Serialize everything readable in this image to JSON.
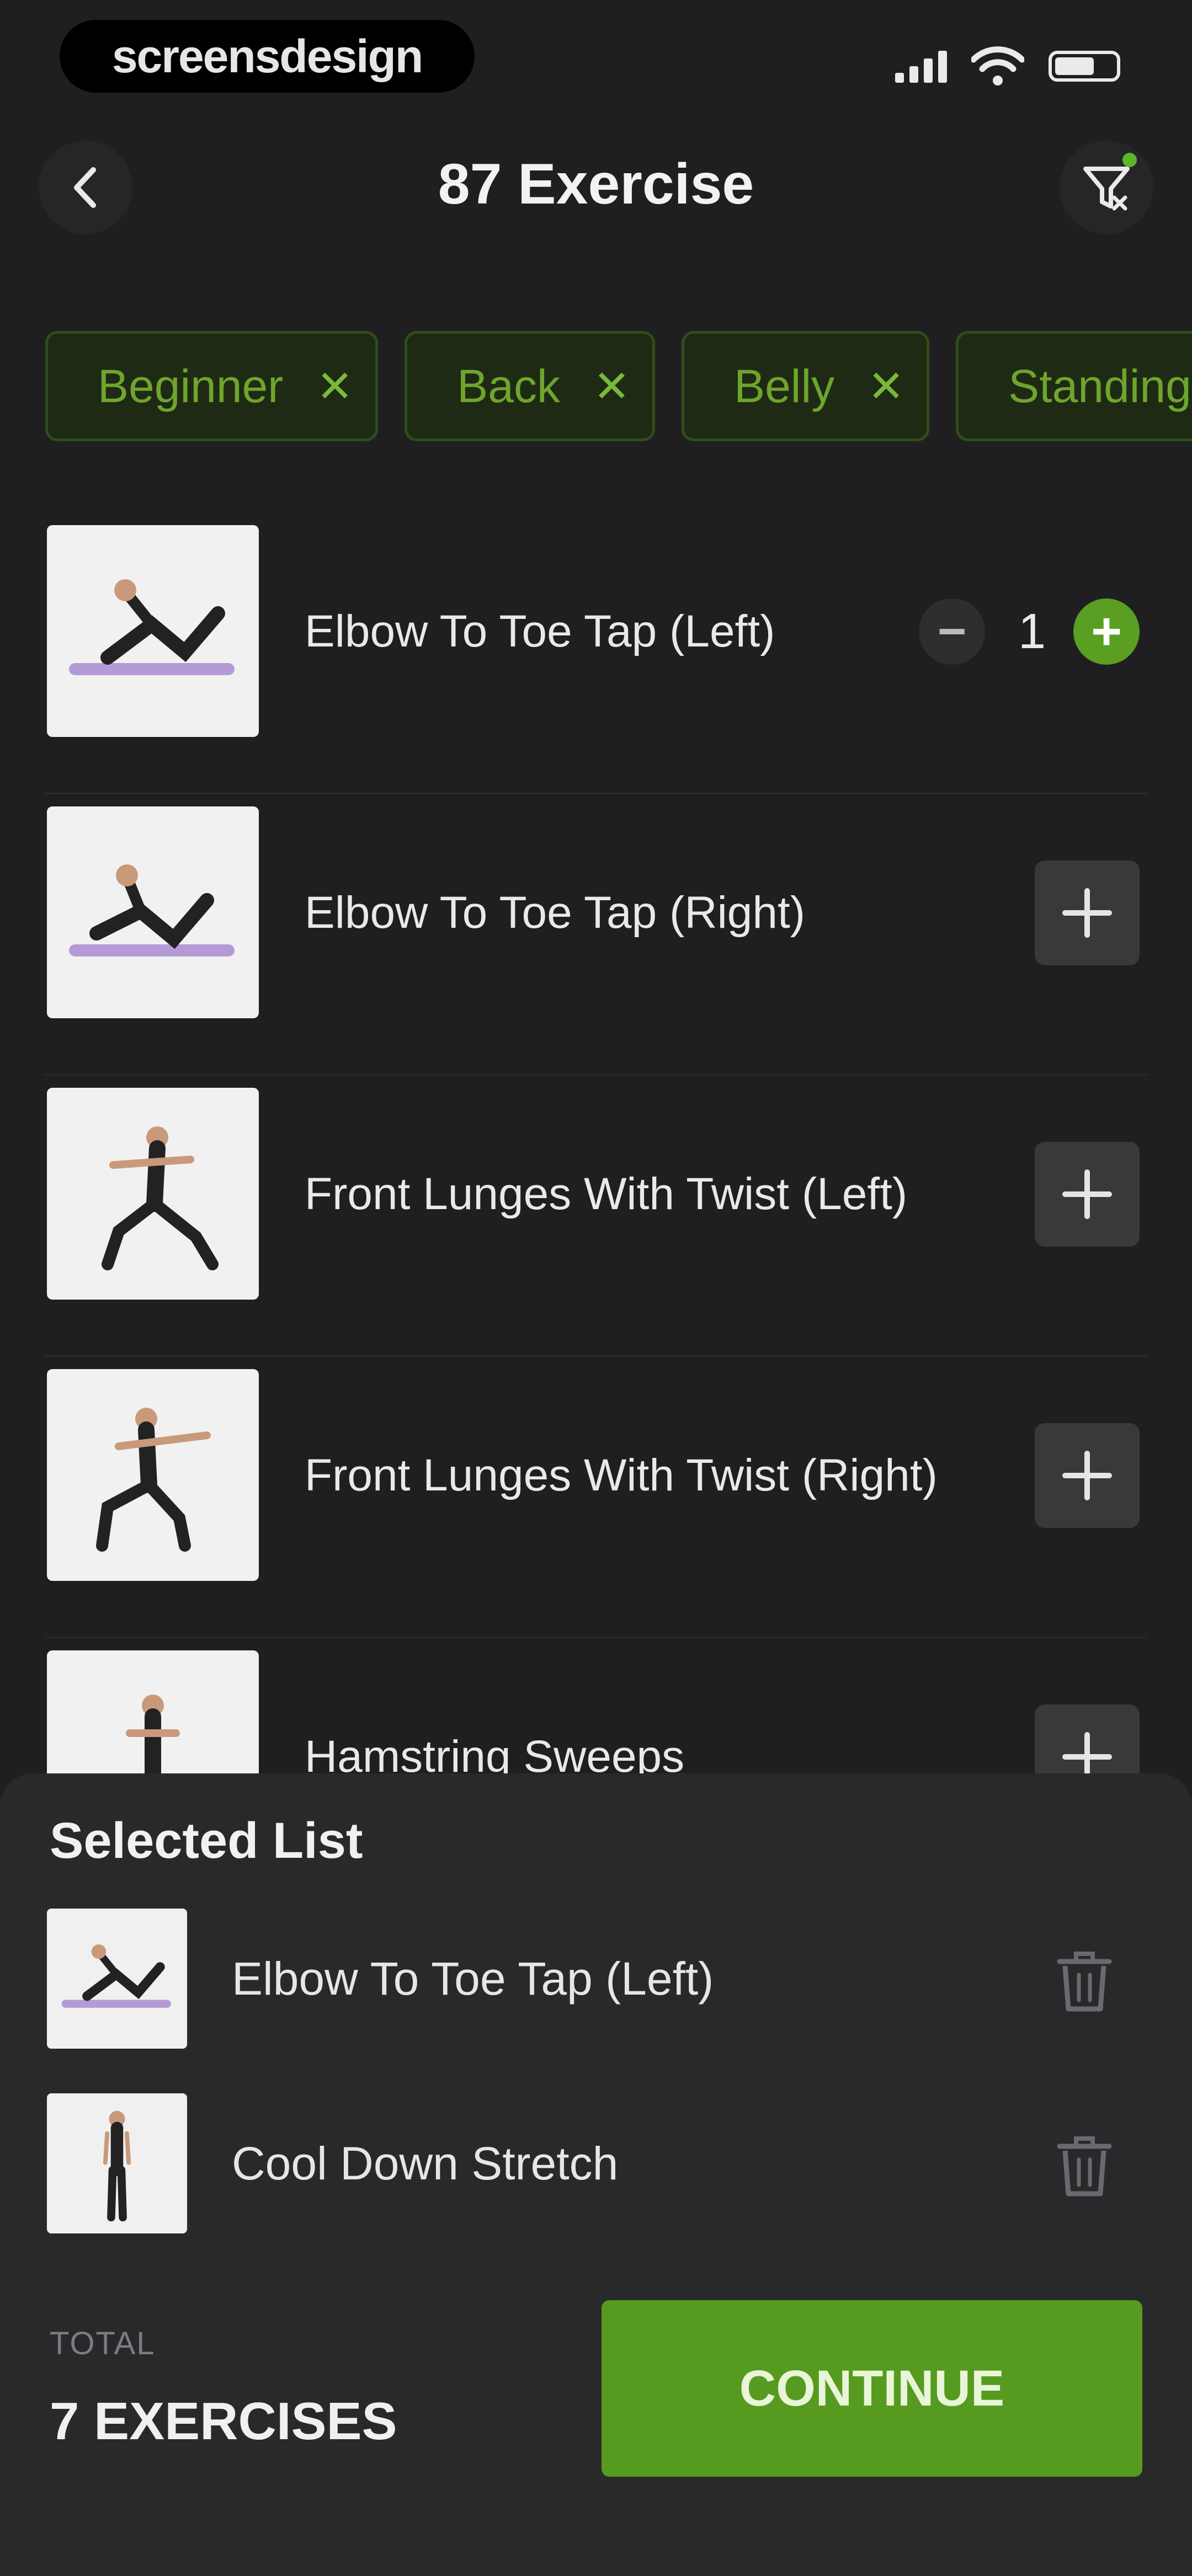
{
  "status_bar": {
    "brand": "screensdesign",
    "icons": [
      "signal-icon",
      "wifi-icon",
      "battery-icon"
    ]
  },
  "header": {
    "title": "87 Exercise",
    "back_icon": "chevron-left-icon",
    "filter_icon": "filter-icon"
  },
  "filters": [
    {
      "label": "Beginner"
    },
    {
      "label": "Back"
    },
    {
      "label": "Belly"
    },
    {
      "label": "Standing"
    }
  ],
  "exercises": [
    {
      "name": "Elbow To Toe Tap (Left)",
      "count": "1",
      "selected": true
    },
    {
      "name": "Elbow To Toe Tap (Right)"
    },
    {
      "name": "Front Lunges With Twist (Left)"
    },
    {
      "name": "Front Lunges With Twist (Right)"
    },
    {
      "name": "Hamstring Sweeps"
    }
  ],
  "selected_list": {
    "title": "Selected List",
    "items": [
      {
        "name": "Elbow To Toe Tap (Left)"
      },
      {
        "name": "Cool Down Stretch"
      }
    ]
  },
  "footer": {
    "total_label": "TOTAL",
    "total_value": "7 EXERCISES",
    "continue_label": "CONTINUE"
  },
  "colors": {
    "background": "#1f1f21",
    "accent": "#569b1f",
    "chip_text": "#6ea52d",
    "sheet": "#29292b"
  }
}
